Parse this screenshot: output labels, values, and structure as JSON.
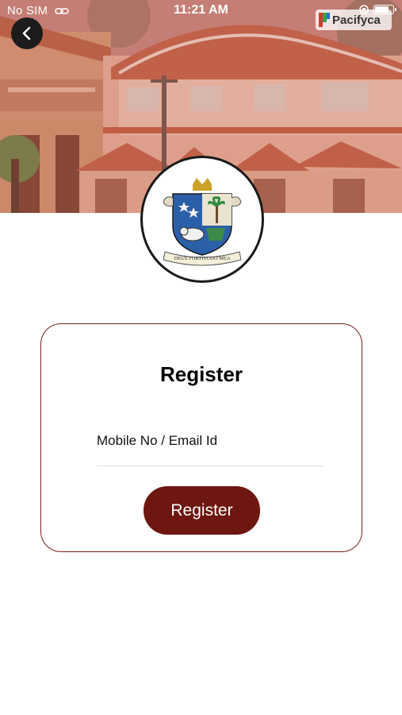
{
  "status_bar": {
    "carrier": "No SIM",
    "time": "11:21 AM"
  },
  "watermark": {
    "text": "Pacifyca"
  },
  "header": {
    "back_icon": "chevron-left-icon",
    "crest_motto": "DEUS FORTITUDO MEA"
  },
  "register_card": {
    "title": "Register",
    "field_placeholder": "Mobile No / Email Id",
    "field_value": "",
    "button_label": "Register"
  },
  "colors": {
    "accent": "#6e1710",
    "card_border": "#7a1f19"
  }
}
